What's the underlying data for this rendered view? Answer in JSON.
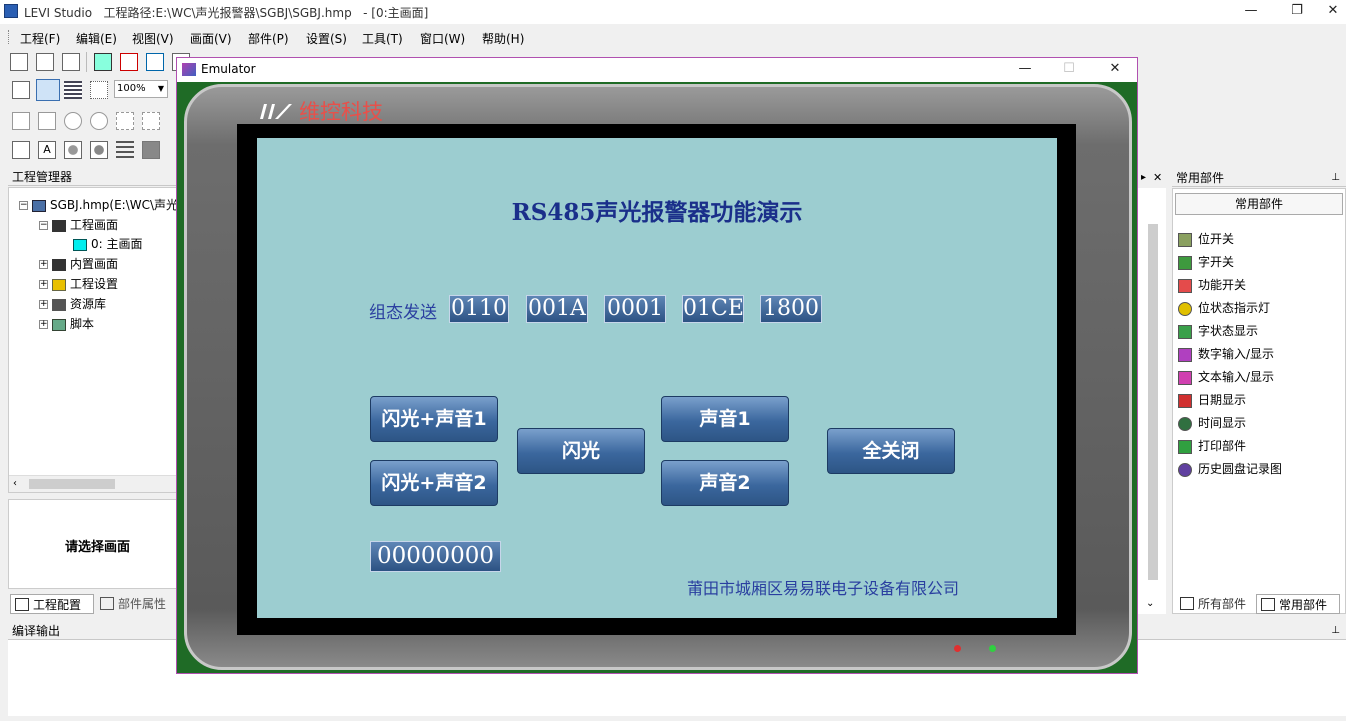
{
  "window": {
    "title": "LEVI Studio   工程路径:E:\\WC\\声光报警器\\SGBJ\\SGBJ.hmp   - [0:主画面]",
    "minimize_glyph": "—",
    "restore_glyph": "❐",
    "close_glyph": "✕"
  },
  "menu": [
    "工程(F)",
    "编辑(E)",
    "视图(V)",
    "画面(V)",
    "部件(P)",
    "设置(S)",
    "工具(T)",
    "窗口(W)",
    "帮助(H)"
  ],
  "toolbar": {
    "zoom": "100%"
  },
  "project_manager": {
    "header": "工程管理器",
    "pin": "ꟷ",
    "tree": [
      {
        "label": "SGBJ.hmp(E:\\WC\\声光",
        "level": 0,
        "expander": "−",
        "icon": "project-icon"
      },
      {
        "label": "工程画面",
        "level": 1,
        "expander": "−",
        "icon": "screens-icon"
      },
      {
        "label": "0: 主画面",
        "level": 2,
        "expander": "",
        "icon": "screen-icon"
      },
      {
        "label": "内置画面",
        "level": 1,
        "expander": "+",
        "icon": "builtin-screens-icon"
      },
      {
        "label": "工程设置",
        "level": 1,
        "expander": "+",
        "icon": "settings-icon"
      },
      {
        "label": "资源库",
        "level": 1,
        "expander": "+",
        "icon": "library-icon"
      },
      {
        "label": "脚本",
        "level": 1,
        "expander": "+",
        "icon": "script-icon"
      }
    ],
    "select_screen_hint": "请选择画面",
    "tabs": [
      "工程配置",
      "部件属性"
    ]
  },
  "parts_panel": {
    "header": "常用部件",
    "subheader": "常用部件",
    "items": [
      {
        "label": "位开关",
        "icon": "bit-switch-icon",
        "color": "#8aa060"
      },
      {
        "label": "字开关",
        "icon": "word-switch-icon",
        "color": "#3e9a3e"
      },
      {
        "label": "功能开关",
        "icon": "function-switch-icon",
        "color": "#e44b4b"
      },
      {
        "label": "位状态指示灯",
        "icon": "bit-lamp-icon",
        "color": "#e0c000"
      },
      {
        "label": "字状态显示",
        "icon": "word-state-icon",
        "color": "#3aa04a"
      },
      {
        "label": "数字输入/显示",
        "icon": "numeric-io-icon",
        "color": "#b040c0"
      },
      {
        "label": "文本输入/显示",
        "icon": "text-io-icon",
        "color": "#d040b0"
      },
      {
        "label": "日期显示",
        "icon": "date-icon",
        "color": "#d03030"
      },
      {
        "label": "时间显示",
        "icon": "clock-icon",
        "color": "#307040"
      },
      {
        "label": "打印部件",
        "icon": "print-icon",
        "color": "#30a040"
      },
      {
        "label": "历史圆盘记录图",
        "icon": "disc-chart-icon",
        "color": "#6040a0"
      }
    ],
    "tabs": [
      "所有部件",
      "常用部件"
    ]
  },
  "compile_output": {
    "header": "编译输出"
  },
  "emulator": {
    "title": "Emulator",
    "brand": "维控科技",
    "screen_title": "RS485声光报警器功能演示",
    "send_label": "组态发送",
    "send_values": [
      "0110",
      "001A",
      "0001",
      "01CE",
      "1800"
    ],
    "buttons": {
      "flash_sound1": "闪光+声音1",
      "flash_sound2": "闪光+声音2",
      "flash": "闪光",
      "sound1": "声音1",
      "sound2": "声音2",
      "all_off": "全关闭"
    },
    "status_value": "00000000",
    "company": "莆田市城厢区易易联电子设备有限公司",
    "led_colors": [
      "#e03030",
      "#30d040"
    ]
  }
}
